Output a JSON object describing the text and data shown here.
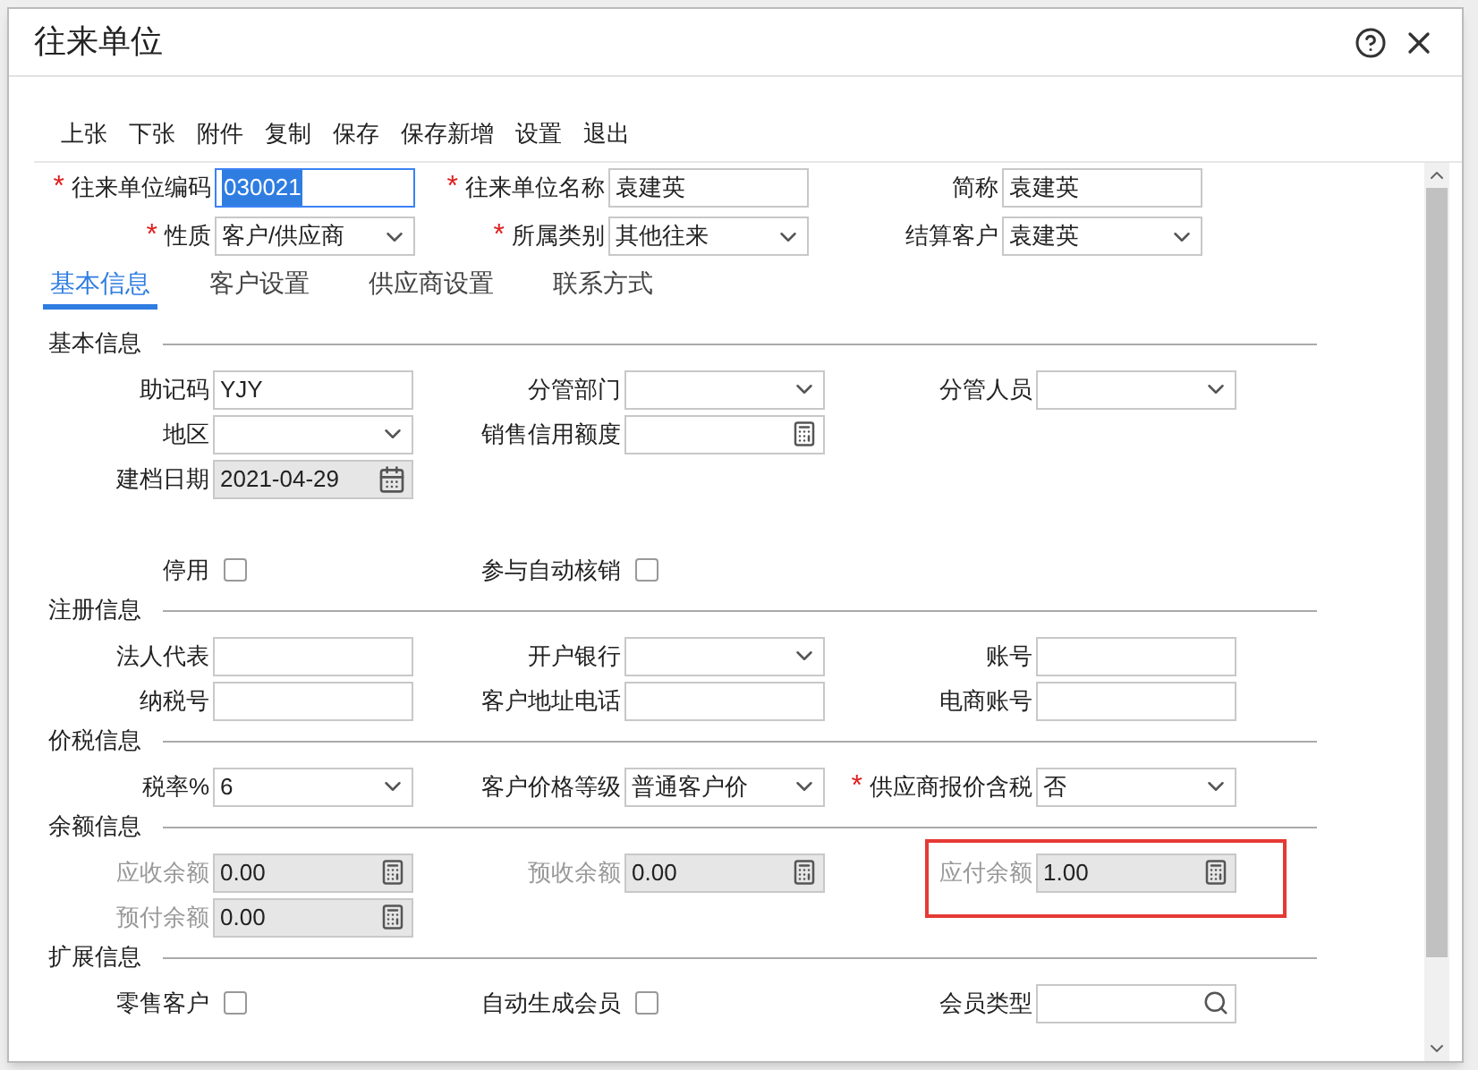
{
  "window": {
    "title": "往来单位"
  },
  "required_mark": "*",
  "toolbar": [
    "上张",
    "下张",
    "附件",
    "复制",
    "保存",
    "保存新增",
    "设置",
    "退出"
  ],
  "header_rows": [
    [
      {
        "label": "往来单位编码",
        "required": true,
        "kind": "text",
        "value": "030021",
        "focused": true
      },
      {
        "label": "往来单位名称",
        "required": true,
        "kind": "text",
        "value": "袁建英",
        "focused": false
      },
      {
        "label": "简称",
        "kind": "text",
        "value": "袁建英",
        "focused": false
      }
    ],
    [
      {
        "label": "性质",
        "required": true,
        "kind": "select",
        "value": "客户/供应商",
        "focused": false
      },
      {
        "label": "所属类别",
        "required": true,
        "kind": "select",
        "value": "其他往来",
        "focused": false
      },
      {
        "label": "结算客户",
        "kind": "select",
        "value": "袁建英",
        "focused": false
      }
    ]
  ],
  "tabs": [
    {
      "label": "基本信息",
      "selected": true
    },
    {
      "label": "客户设置",
      "selected": false
    },
    {
      "label": "供应商设置",
      "selected": false
    },
    {
      "label": "联系方式",
      "selected": false
    }
  ],
  "sections": [
    {
      "title": "基本信息",
      "rows": [
        [
          {
            "label": "助记码",
            "kind": "text",
            "value": "YJY"
          },
          {
            "label": "分管部门",
            "kind": "select"
          },
          {
            "label": "分管人员",
            "kind": "select"
          }
        ],
        [
          {
            "label": "地区",
            "kind": "select"
          },
          {
            "label": "销售信用额度",
            "kind": "calc",
            "disabled": false
          }
        ],
        [
          {
            "label": "建档日期",
            "kind": "date",
            "value": "2021-04-29"
          }
        ],
        [
          {
            "label": "停用",
            "kind": "checkbox",
            "checked": false
          },
          {
            "label": "参与自动核销",
            "kind": "checkbox",
            "checked": false
          }
        ]
      ]
    },
    {
      "title": "注册信息",
      "rows": [
        [
          {
            "label": "法人代表",
            "kind": "text"
          },
          {
            "label": "开户银行",
            "kind": "select"
          },
          {
            "label": "账号",
            "kind": "text"
          }
        ],
        [
          {
            "label": "纳税号",
            "kind": "text"
          },
          {
            "label": "客户地址电话",
            "kind": "text"
          },
          {
            "label": "电商账号",
            "kind": "text"
          }
        ]
      ]
    },
    {
      "title": "价税信息",
      "rows": [
        [
          {
            "label": "税率%",
            "kind": "select",
            "value": "6"
          },
          {
            "label": "客户价格等级",
            "kind": "select",
            "value": "普通客户价"
          },
          {
            "label": "供应商报价含税",
            "kind": "select",
            "value": "否",
            "required": true
          }
        ]
      ]
    },
    {
      "title": "余额信息",
      "rows": [
        [
          {
            "label": "应收余额",
            "kind": "calc",
            "value": "0.00",
            "disabled": true
          },
          {
            "label": "预收余额",
            "kind": "calc",
            "value": "0.00",
            "disabled": true
          },
          {
            "label": "应付余额",
            "kind": "calc",
            "value": "1.00",
            "disabled": true,
            "highlighted": true
          }
        ],
        [
          {
            "label": "预付余额",
            "kind": "calc",
            "value": "0.00",
            "disabled": true
          }
        ]
      ]
    },
    {
      "title": "扩展信息",
      "rows": [
        [
          {
            "label": "零售客户",
            "kind": "checkbox",
            "checked": false
          },
          {
            "label": "自动生成会员",
            "kind": "checkbox",
            "checked": false
          },
          {
            "label": "会员类型",
            "kind": "search"
          }
        ]
      ]
    }
  ]
}
